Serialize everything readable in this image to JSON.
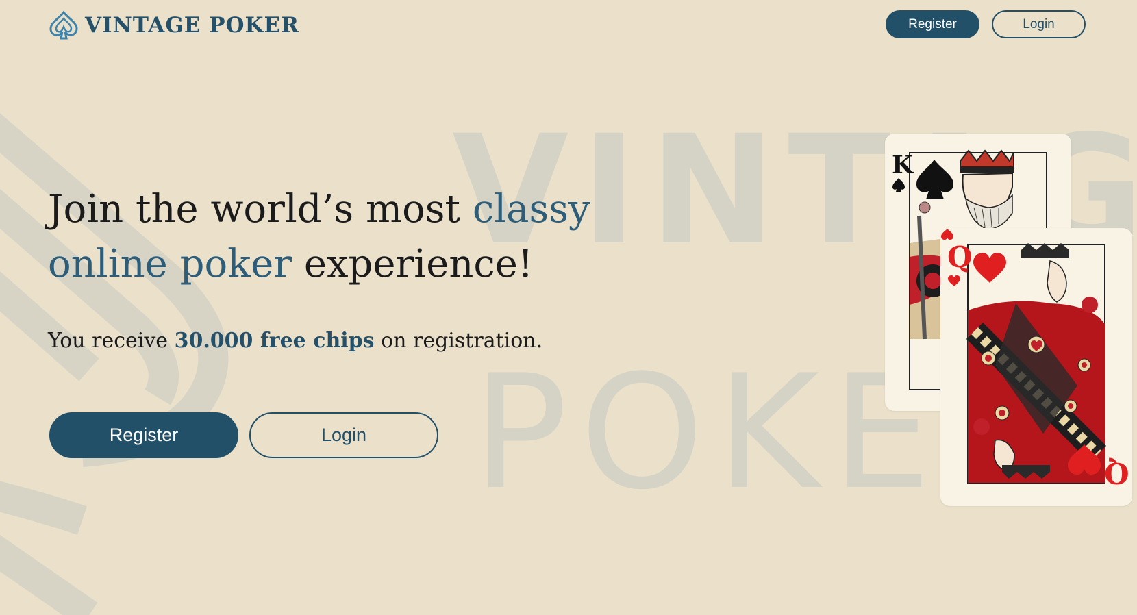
{
  "brand": {
    "name": "VINTAGE POKER"
  },
  "nav": {
    "register_label": "Register",
    "login_label": "Login"
  },
  "hero": {
    "title_part1": "Join the world’s most ",
    "title_accent1": "classy",
    "title_accent2": "online poker",
    "title_part2": " experience!",
    "sub_part1": "You receive ",
    "sub_accent": "30.000 free chips",
    "sub_part2": " on registration.",
    "register_label": "Register",
    "login_label": "Login"
  },
  "background": {
    "word1": "VINTAGE",
    "word2": "POKER"
  },
  "cards": {
    "king": {
      "rank": "K",
      "suit": "spade-icon"
    },
    "queen": {
      "rank": "Q",
      "suit": "heart-icon"
    }
  },
  "colors": {
    "background": "#ebe1cb",
    "primary": "#225068",
    "accent_text": "#2d5d78",
    "heart_red": "#e02020"
  }
}
